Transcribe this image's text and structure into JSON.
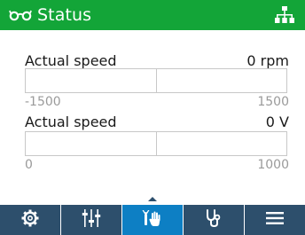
{
  "header": {
    "title": "Status",
    "left_icon": "glasses-icon",
    "right_icon": "network-icon",
    "color": "#13a538"
  },
  "meters": [
    {
      "label": "Actual speed",
      "value": "0 rpm",
      "min": "-1500",
      "max": "1500",
      "fill_fraction": 0
    },
    {
      "label": "Actual speed",
      "value": "0 V",
      "min": "0",
      "max": "1000",
      "fill_fraction": 0
    }
  ],
  "nav": {
    "background": "#2d4f6c",
    "active_color": "#0d7fc4",
    "tabs": [
      {
        "icon": "gear-icon",
        "active": false
      },
      {
        "icon": "sliders-icon",
        "active": false
      },
      {
        "icon": "wrench-hand-icon",
        "active": true
      },
      {
        "icon": "stethoscope-icon",
        "active": false
      },
      {
        "icon": "menu-icon",
        "active": false
      }
    ]
  }
}
